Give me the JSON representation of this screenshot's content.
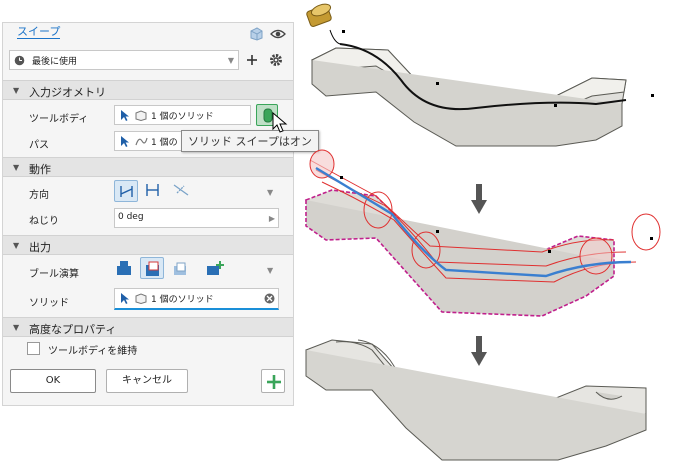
{
  "panel": {
    "title": "スイープ",
    "preset": "最後に使用",
    "sections": {
      "input": "入力ジオメトリ",
      "motion": "動作",
      "output": "出力",
      "advanced": "高度なプロパティ"
    },
    "tool_body_label": "ツールボディ",
    "tool_body_value": "1 個のソリッド",
    "path_label": "パス",
    "path_value": "1 個の",
    "direction_label": "方向",
    "twist_label": "ねじり",
    "twist_value": "0 deg",
    "boolean_label": "ブール演算",
    "solid_label": "ソリッド",
    "solid_value": "1 個のソリッド",
    "keep_tool_label": "ツールボディを維持",
    "ok_label": "OK",
    "cancel_label": "キャンセル"
  },
  "tooltip": "ソリッド スイープはオン",
  "colors": {
    "accent": "#1a73c8",
    "active_green": "#3aa55a",
    "swept_red": "#e03030",
    "selection_magenta": "#c0208c"
  },
  "icons": [
    "eye-icon",
    "cube-icon",
    "plus-icon",
    "gear-icon",
    "clock-icon",
    "cursor-icon",
    "down-arrow-icon"
  ]
}
